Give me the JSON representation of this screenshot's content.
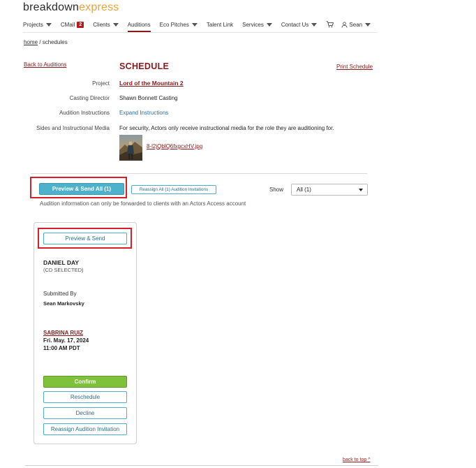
{
  "brand": {
    "part1": "breakdown",
    "part2": "express"
  },
  "nav": {
    "items": [
      {
        "label": "Projects",
        "caret": true
      },
      {
        "label": "CMail",
        "badge": "2"
      },
      {
        "label": "Clients",
        "caret": true
      },
      {
        "label": "Auditions",
        "active": true
      },
      {
        "label": "Eco Pitches",
        "caret": true
      },
      {
        "label": "Talent Link"
      },
      {
        "label": "Services",
        "caret": true
      },
      {
        "label": "Contact Us",
        "caret": true
      }
    ],
    "user": "Sean"
  },
  "breadcrumb": {
    "home": "home",
    "separator": " / ",
    "current": "schedules"
  },
  "links": {
    "back_to_auditions": "Back to Auditions",
    "print_schedule": "Print Schedule",
    "back_to_top": "back to top ^"
  },
  "schedule": {
    "title": "SCHEDULE",
    "labels": {
      "project": "Project",
      "casting_director": "Casting Director",
      "audition_instructions": "Audition Instructions",
      "sides_media": "Sides and Instructional Media"
    },
    "values": {
      "project": "Lord of the Mountain 2",
      "casting_director": "Shawn Bonnett Casting",
      "audition_instructions": "Expand Instructions",
      "sides_media": "For security, Actors only receive instructional media for the role they are auditioning for.",
      "media_file": "8-l2jQblQ6fxgcxHV.jpg"
    }
  },
  "toolbar": {
    "preview_send_all": "Preview & Send All (1)",
    "reassign_all": "Reassign All (1) Audition Invitations",
    "show_label": "Show",
    "show_selected": "All (1)",
    "note": "Audition information can only be forwarded to clients with an Actors Access account"
  },
  "card": {
    "preview_send": "Preview & Send",
    "actor_name": "DANIEL DAY",
    "actor_status": "(CD SELECTED)",
    "submitted_by_label": "Submitted By",
    "submitted_by": "Sean Markovsky",
    "reader": "SABRINA RUIZ",
    "date": "Fri. May. 17, 2024",
    "time": "11:00 AM PDT",
    "buttons": {
      "confirm": "Confirm",
      "reschedule": "Reschedule",
      "decline": "Decline",
      "reassign": "Reassign Audition Invitation"
    }
  },
  "colors": {
    "brand_red": "#8b1a1a",
    "accent_blue": "#4eb1cc",
    "confirm_green": "#7fc13b",
    "highlight": "#d61f26"
  }
}
